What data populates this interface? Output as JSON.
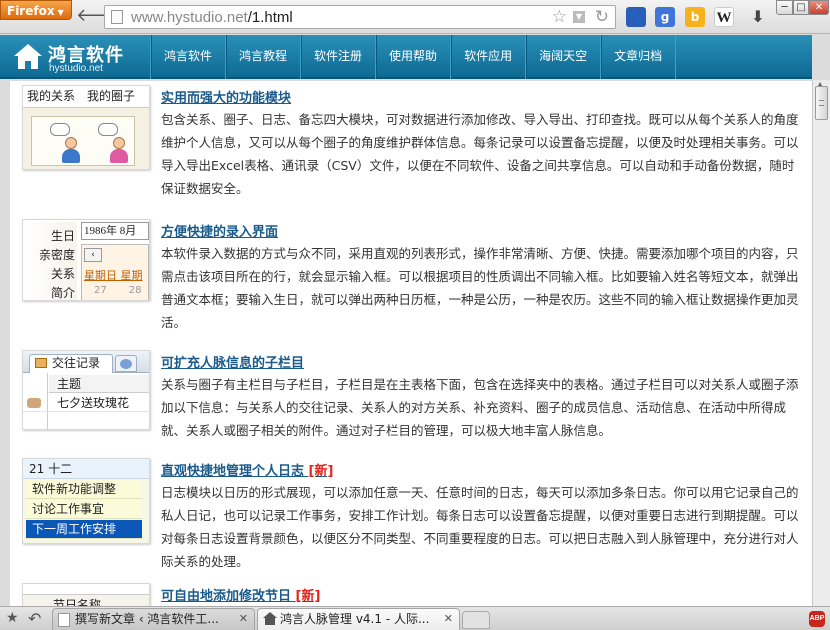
{
  "browser": {
    "menu_label": "Firefox",
    "url_domain": "www.hystudio.net",
    "url_path": "/1.html",
    "search_icons": [
      "baidu-icon",
      "google-icon",
      "bing-icon",
      "wikipedia-icon"
    ],
    "google_letter": "g",
    "bing_letter": "b",
    "wiki_letter": "W",
    "tabs": [
      {
        "title": "撰写新文章 ‹ 鸿言软件工...",
        "active": false
      },
      {
        "title": "鸿言人脉管理 v4.1 - 人际...",
        "active": true
      }
    ],
    "abp_label": "ABP"
  },
  "site": {
    "logo_name": "鸿言软件",
    "logo_domain": "hystudio.net",
    "nav": [
      "鸿言软件",
      "鸿言教程",
      "软件注册",
      "使用帮助",
      "软件应用",
      "海阔天空",
      "文章归档"
    ],
    "brand_color": "#1b7fa8"
  },
  "features": [
    {
      "title": "实用而强大的功能模块",
      "is_new": false,
      "description": "包含关系、圈子、日志、备忘四大模块，可对数据进行添加修改、导入导出、打印查找。既可以从每个关系人的角度维护个人信息，又可以从每个圈子的角度维护群体信息。每条记录可以设置备忘提醒，以便及时处理相关事务。可以导入导出Excel表格、通讯录（CSV）文件，以便在不同软件、设备之间共享信息。可以自动和手动备份数据，随时保证数据安全。",
      "thumb": {
        "tabs": [
          "我的关系",
          "我的圈子"
        ]
      }
    },
    {
      "title": "方便快捷的录入界面",
      "is_new": false,
      "description": "本软件录入数据的方式与众不同，采用直观的列表形式，操作非常清晰、方便、快捷。需要添加哪个项目的内容，只需点击该项目所在的行，就会显示输入框。可以根据项目的性质调出不同输入框。比如要输入姓名等短文本，就弹出普通文本框；要输入生日，就可以弹出两种日历框，一种是公历，一种是农历。这些不同的输入框让数据操作更加灵活。",
      "thumb": {
        "fields": [
          "生日",
          "亲密度",
          "关系",
          "简介"
        ],
        "date_value": "1986年 8月",
        "weekdays": "星期日 星期",
        "day_numbers": [
          "27",
          "28"
        ]
      }
    },
    {
      "title": "可扩充人脉信息的子栏目",
      "is_new": false,
      "description": "关系与圈子有主栏目与子栏目，子栏目是在主表格下面，包含在选择夹中的表格。通过子栏目可以对关系人或圈子添加以下信息：与关系人的交往记录、关系人的对方关系、补充资料、圈子的成员信息、活动信息、在活动中所得成就、关系人或圈子相关的附件。通过对子栏目的管理，可以极大地丰富人脉信息。",
      "thumb": {
        "tab_label": "交往记录",
        "column": "主题",
        "row": "七夕送玫瑰花"
      }
    },
    {
      "title": "直观快捷地管理个人日志",
      "is_new": true,
      "new_label": "[新]",
      "description": "日志模块以日历的形式展现，可以添加任意一天、任意时间的日志，每天可以添加多条日志。你可以用它记录自己的私人日记，也可以记录工作事务，安排工作计划。每条日志可以设置备忘提醒，以便对重要日志进行到期提醒。可以对每条日志设置背景颜色，以便区分不同类型、不同重要程度的日志。可以把日志融入到人脉管理中，充分进行对人际关系的处理。",
      "thumb": {
        "header": "21 十二",
        "items": [
          "软件新功能调整",
          "讨论工作事宜",
          "下一周工作安排"
        ]
      }
    },
    {
      "title": "可自由地添加修改节日",
      "is_new": true,
      "new_label": "[新]",
      "description": "",
      "thumb": {
        "header": "节日名称"
      }
    }
  ]
}
